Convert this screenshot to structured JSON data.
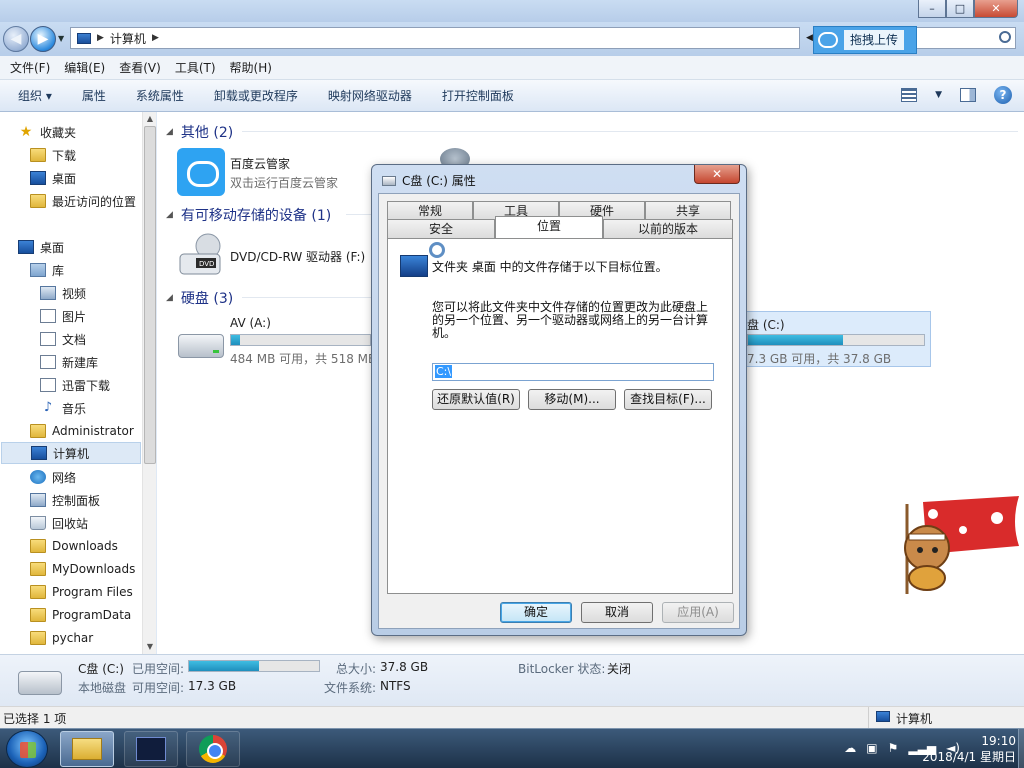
{
  "window": {
    "address_path": "计算机",
    "search_placeholder": "",
    "upload_button": "拖拽上传",
    "controls": {
      "minimize": "–",
      "maximize": "□",
      "close": "✕"
    }
  },
  "menu": [
    "文件(F)",
    "编辑(E)",
    "查看(V)",
    "工具(T)",
    "帮助(H)"
  ],
  "toolbar": [
    "组织 ▾",
    "属性",
    "系统属性",
    "卸载或更改程序",
    "映射网络驱动器",
    "打开控制面板"
  ],
  "navpane": {
    "favorites": "收藏夹",
    "downloads": "下载",
    "desktop_fav": "桌面",
    "recent": "最近访问的位置",
    "desktop": "桌面",
    "library": "库",
    "video": "视频",
    "pictures": "图片",
    "documents": "文档",
    "newlib": "新建库",
    "xunlei": "迅雷下载",
    "music": "音乐",
    "admin": "Administrator",
    "computer": "计算机",
    "network": "网络",
    "controlpanel": "控制面板",
    "recycle": "回收站",
    "dl": "Downloads",
    "mydl": "MyDownloads",
    "progfiles": "Program Files",
    "progdata": "ProgramData",
    "pychar": "pychar"
  },
  "content": {
    "group_other": "其他 (2)",
    "baidu_name": "百度云管家",
    "baidu_sub": "双击运行百度云管家",
    "group_removable": "有可移动存储的设备 (1)",
    "dvd_name": "DVD/CD-RW 驱动器 (F:)",
    "group_hdd": "硬盘 (3)",
    "av_name": "AV (A:)",
    "av_space": "484 MB 可用，共 518 MB",
    "av_used_fraction": 0.066,
    "c_name": "盘 (C:)",
    "c_space": "7.3 GB 可用，共 37.8 GB",
    "c_used_fraction": 0.54
  },
  "details": {
    "drive_name": "C盘 (C:)",
    "used_label": "已用空间:",
    "type": "本地磁盘",
    "free_label": "可用空间:",
    "free_value": "17.3 GB",
    "total_label": "总大小:",
    "total_value": "37.8 GB",
    "fs_label": "文件系统:",
    "fs_value": "NTFS",
    "bitlocker_label": "BitLocker 状态:",
    "bitlocker_value": "关闭",
    "used_fraction": 0.54
  },
  "status": {
    "selected": "已选择 1 项",
    "location": "计算机"
  },
  "dialog": {
    "title": "C盘 (C:) 属性",
    "tabs_row1": [
      "常规",
      "工具",
      "硬件",
      "共享"
    ],
    "tabs_row2": [
      "安全",
      "位置",
      "以前的版本"
    ],
    "active_tab": "位置",
    "line1": "文件夹 桌面 中的文件存储于以下目标位置。",
    "line2": "您可以将此文件夹中文件存储的位置更改为此硬盘上的另一个位置、另一个驱动器或网络上的另一台计算机。",
    "path_value": "C:\\",
    "btn_restore": "还原默认值(R)",
    "btn_move": "移动(M)...",
    "btn_find": "查找目标(F)...",
    "ok": "确定",
    "cancel": "取消",
    "apply": "应用(A)"
  },
  "taskbar": {
    "time": "19:10",
    "date": "2018/4/1 星期日"
  },
  "colors": {
    "accent": "#1e3287",
    "drive_bar": "#1f8fbd",
    "taskbar": "#1d3148"
  }
}
